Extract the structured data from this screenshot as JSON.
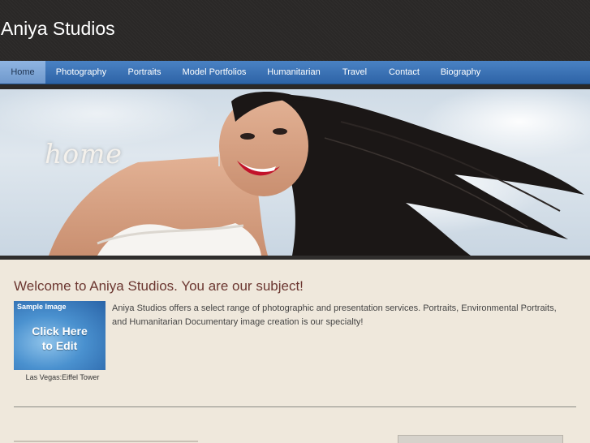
{
  "site": {
    "title": "Aniya Studios"
  },
  "nav": {
    "items": [
      {
        "label": "Home"
      },
      {
        "label": "Photography"
      },
      {
        "label": "Portraits"
      },
      {
        "label": "Model Portfolios"
      },
      {
        "label": "Humanitarian"
      },
      {
        "label": "Travel"
      },
      {
        "label": "Contact"
      },
      {
        "label": "Biography"
      }
    ],
    "active_index": 0
  },
  "hero": {
    "overlay_text": "home"
  },
  "content": {
    "heading": "Welcome to Aniya Studios. You are our subject!",
    "image": {
      "badge": "Sample Image",
      "line1": "Click Here",
      "line2": "to Edit",
      "caption": "Las Vegas:Eiffel Tower"
    },
    "paragraph": "Aniya Studios offers a select range of photographic and presentation services. Portraits, Environmental Portraits, and Humanitarian Documentary image creation is our specialty!"
  },
  "colors": {
    "header_bg": "#2a2827",
    "nav_blue": "#2d63a6",
    "heading_color": "#6b3630",
    "page_bg": "#efe8dc"
  }
}
